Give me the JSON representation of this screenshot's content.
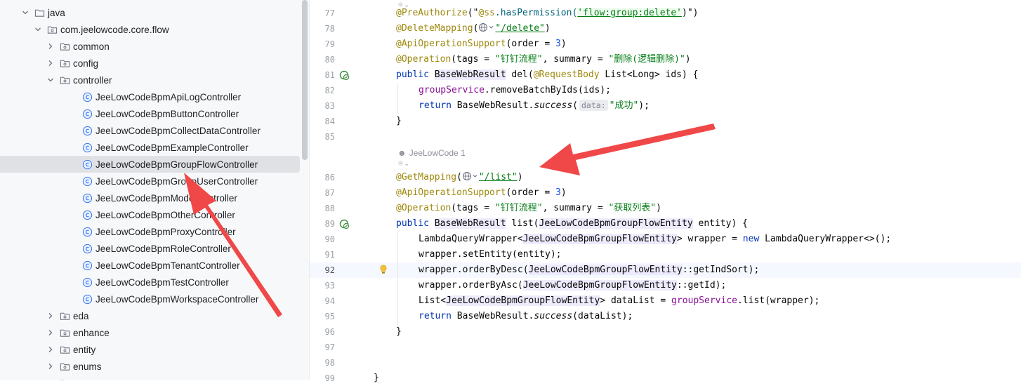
{
  "tree": {
    "items": [
      {
        "label": "java",
        "type": "folder",
        "expanded": true,
        "level": 2
      },
      {
        "label": "com.jeelowcode.core.flow",
        "type": "package",
        "expanded": true,
        "level": 3
      },
      {
        "label": "common",
        "type": "package",
        "expanded": false,
        "level": 4
      },
      {
        "label": "config",
        "type": "package",
        "expanded": false,
        "level": 4
      },
      {
        "label": "controller",
        "type": "package",
        "expanded": true,
        "level": 4
      },
      {
        "label": "JeeLowCodeBpmApiLogController",
        "type": "class",
        "level": 5
      },
      {
        "label": "JeeLowCodeBpmButtonController",
        "type": "class",
        "level": 5
      },
      {
        "label": "JeeLowCodeBpmCollectDataController",
        "type": "class",
        "level": 5
      },
      {
        "label": "JeeLowCodeBpmExampleController",
        "type": "class",
        "level": 5
      },
      {
        "label": "JeeLowCodeBpmGroupFlowController",
        "type": "class",
        "level": 5,
        "selected": true
      },
      {
        "label": "JeeLowCodeBpmGroupUserController",
        "type": "class",
        "level": 5
      },
      {
        "label": "JeeLowCodeBpmModelController",
        "type": "class",
        "level": 5
      },
      {
        "label": "JeeLowCodeBpmOtherController",
        "type": "class",
        "level": 5
      },
      {
        "label": "JeeLowCodeBpmProxyController",
        "type": "class",
        "level": 5
      },
      {
        "label": "JeeLowCodeBpmRoleController",
        "type": "class",
        "level": 5
      },
      {
        "label": "JeeLowCodeBpmTenantController",
        "type": "class",
        "level": 5
      },
      {
        "label": "JeeLowCodeBpmTestController",
        "type": "class",
        "level": 5
      },
      {
        "label": "JeeLowCodeBpmWorkspaceController",
        "type": "class",
        "level": 5
      },
      {
        "label": "eda",
        "type": "package",
        "expanded": false,
        "level": 4
      },
      {
        "label": "enhance",
        "type": "package",
        "expanded": false,
        "level": 4
      },
      {
        "label": "entity",
        "type": "package",
        "expanded": false,
        "level": 4
      },
      {
        "label": "enums",
        "type": "package",
        "expanded": false,
        "level": 4
      },
      {
        "label": "",
        "type": "package",
        "expanded": false,
        "level": 4
      }
    ]
  },
  "editor": {
    "line_numbers": [
      "77",
      "78",
      "79",
      "80",
      "81",
      "82",
      "83",
      "84",
      "85",
      "86",
      "87",
      "88",
      "89",
      "90",
      "91",
      "92",
      "93",
      "94",
      "95",
      "96",
      "97",
      "98",
      "99"
    ],
    "current_line": "92",
    "author_hint": "JeeLowCode 1",
    "param_hint": "data:",
    "tokens": {
      "pre_authorize": "@PreAuthorize",
      "ss_perm_open": "(\"",
      "ss_at": "@ss",
      "has_perm": ".hasPermission(",
      "perm_str": "'flow:group:delete'",
      "perm_close": ")\")",
      "delete_mapping": "@DeleteMapping",
      "open_paren": "(",
      "delete_path": "\"/delete\"",
      "close_paren": ")",
      "api_op_support": "@ApiOperationSupport",
      "order_eq": "(order = ",
      "order_val": "3",
      "operation": "@Operation",
      "tags_eq": "(tags = ",
      "tag_str": "\"钉钉流程\"",
      "summary_eq": ", summary = ",
      "sum_del": "\"删除(逻辑删除)\"",
      "sum_list": "\"获取列表\"",
      "public": "public ",
      "base_web_result": "BaseWebResult",
      "del_sig": " del(",
      "request_body": "@RequestBody",
      "del_params": " List<Long> ids) {",
      "group_service": "groupService",
      "remove_call": ".removeBatchByIds(ids);",
      "return": "return ",
      "bwr_dot": "BaseWebResult.",
      "success": "success",
      "success_str": "\"成功\"",
      "close_stmt": ");",
      "brace_close": "}",
      "get_mapping": "@GetMapping",
      "list_path": "\"/list\"",
      "list_sig": " list(",
      "entity_cls": "JeeLowCodeBpmGroupFlowEntity",
      "entity_param": " entity) {",
      "lqw": "LambdaQueryWrapper<",
      "wrapper_eq": "> wrapper = ",
      "new": "new",
      "lqw_new": " LambdaQueryWrapper<>();",
      "set_entity": "wrapper.setEntity(entity);",
      "order_desc": "wrapper.orderByDesc(",
      "get_ind_sort": "::getIndSort);",
      "order_asc": "wrapper.orderByAsc(",
      "get_id": "::getId);",
      "list_lt": "List<",
      "data_list_eq": "> dataList = ",
      "list_call": ".list(wrapper);",
      "data_list_ret": "(dataList);"
    }
  }
}
